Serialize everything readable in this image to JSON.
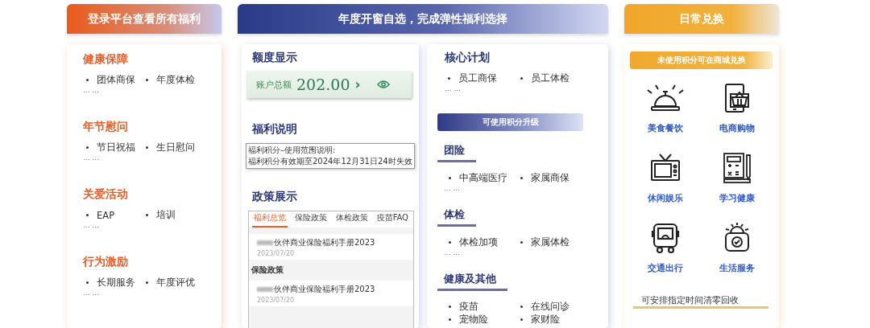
{
  "login_panel": {
    "title": "登录平台查看所有福利",
    "groups": [
      {
        "heading": "健康保障",
        "items": [
          "团体商保",
          "年度体检"
        ],
        "more": "... ..."
      },
      {
        "heading": "年节慰问",
        "items": [
          "节日祝福",
          "生日慰问"
        ],
        "more": "... ..."
      },
      {
        "heading": "关爱活动",
        "items": [
          "EAP",
          "培训"
        ],
        "more": "... ..."
      },
      {
        "heading": "行为激励",
        "items": [
          "长期服务",
          "年度评优"
        ],
        "more": "... ..."
      }
    ]
  },
  "selection_panel": {
    "title": "年度开窗自选，完成弹性福利选择",
    "quota": {
      "heading": "额度显示",
      "label": "账户总额",
      "amount": "202.00",
      "arrow": "›"
    },
    "notice": {
      "heading": "福利说明",
      "lines": [
        "福利积分–使用范围说明:",
        "福利积分有效期至2024年12月31日24时失效"
      ]
    },
    "policy": {
      "heading": "政策展示",
      "tabs": [
        {
          "label": "福利总览",
          "selected": true
        },
        {
          "label": "保险政策",
          "selected": false
        },
        {
          "label": "体检政策",
          "selected": false
        },
        {
          "label": "疫苗FAQ",
          "selected": false
        }
      ],
      "entries": [
        {
          "kind": "doc",
          "title": "伙伴商业保险福利手册2023",
          "date": "2023/07/20"
        },
        {
          "kind": "section",
          "title": "保险政策"
        },
        {
          "kind": "doc",
          "title": "伙伴商业保险福利手册2023",
          "date": "2023/07/20"
        }
      ]
    },
    "core": {
      "heading": "核心计划",
      "items": [
        "员工商保",
        "员工体检"
      ],
      "more": "... ..."
    },
    "upgrade": {
      "title": "可使用积分升级",
      "groups": [
        {
          "heading": "团险",
          "items": [
            "中高端医疗",
            "家属商保"
          ],
          "more": "... ..."
        },
        {
          "heading": "体检",
          "items": [
            "体检加项",
            "家属体检"
          ],
          "more": "... ..."
        },
        {
          "heading": "健康及其他",
          "items": [
            "疫苗",
            "在线问诊",
            "宠物险",
            "家财险"
          ]
        }
      ]
    }
  },
  "exchange_panel": {
    "title": "日常兑换",
    "banner": "未使用积分可在商城兑换",
    "services": [
      {
        "kind": "bell",
        "label": "美食餐饮"
      },
      {
        "kind": "tablet",
        "label": "电商购物"
      },
      {
        "kind": "tv",
        "label": "休闲娱乐"
      },
      {
        "kind": "calculator",
        "label": "学习健康"
      },
      {
        "kind": "bus",
        "label": "交通出行"
      },
      {
        "kind": "gear",
        "label": "生活服务"
      }
    ],
    "footer": "可安排指定时间清零回收"
  }
}
